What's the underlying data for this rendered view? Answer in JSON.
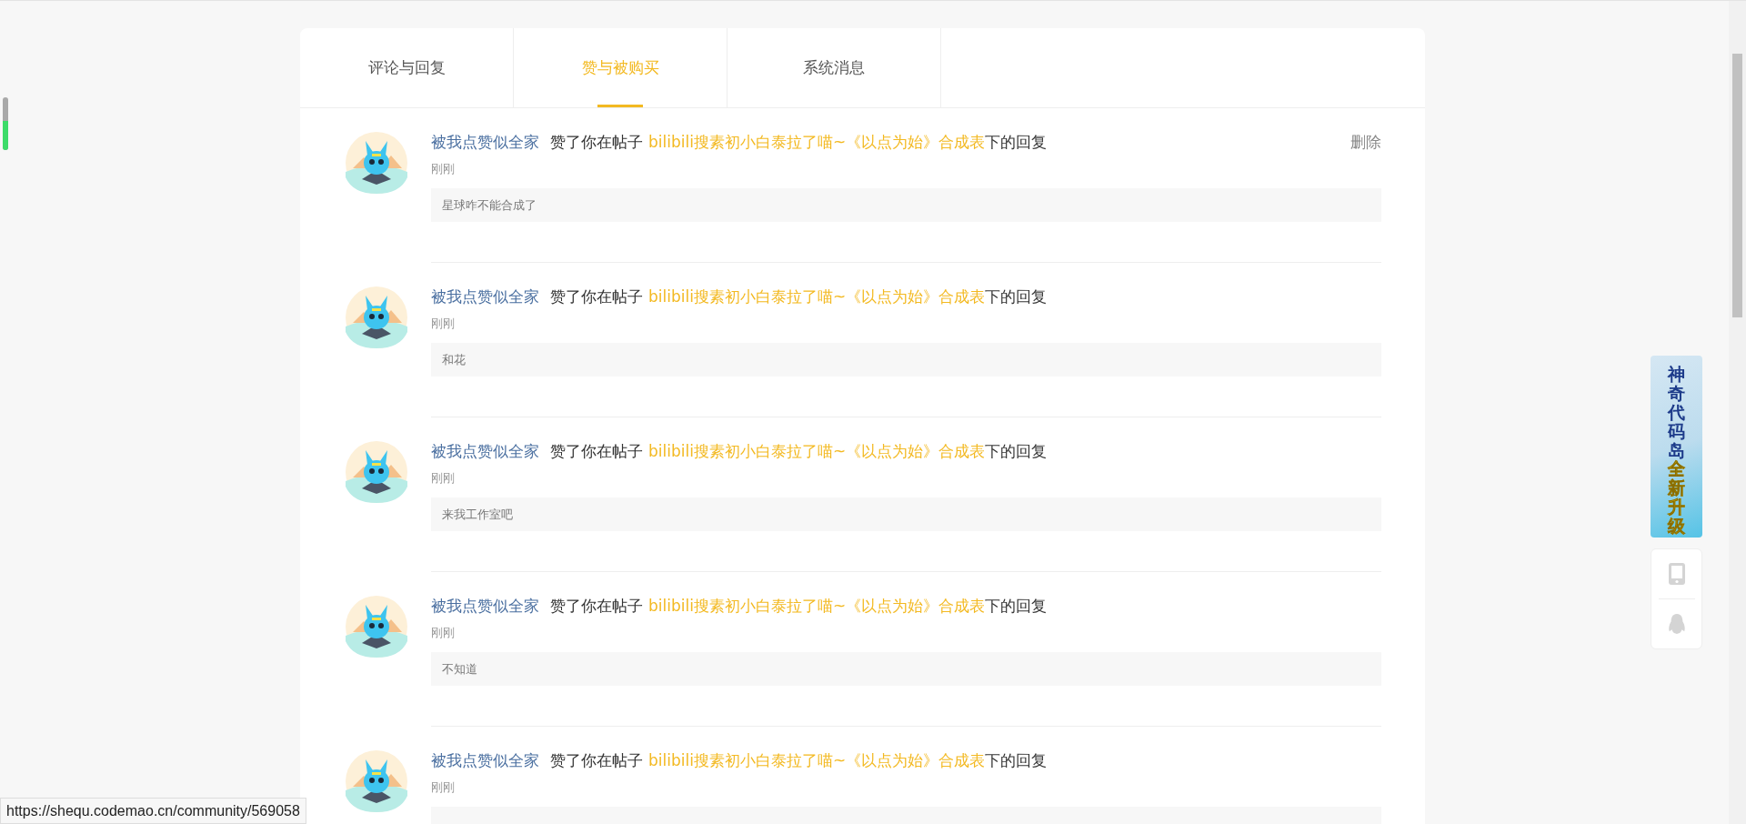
{
  "tabs": [
    {
      "label": "评论与回复",
      "selected": false
    },
    {
      "label": "赞与被购买",
      "selected": true
    },
    {
      "label": "系统消息",
      "selected": false
    }
  ],
  "notifications": [
    {
      "user": "被我点赞似全家",
      "action": "赞了你在帖子",
      "post": "bilibili搜素初小白泰拉了喵~《以点为始》合成表",
      "suffix": "下的回复",
      "time": "刚刚",
      "comment": "星球咋不能合成了",
      "delete": "删除"
    },
    {
      "user": "被我点赞似全家",
      "action": "赞了你在帖子",
      "post": "bilibili搜素初小白泰拉了喵~《以点为始》合成表",
      "suffix": "下的回复",
      "time": "刚刚",
      "comment": "和花"
    },
    {
      "user": "被我点赞似全家",
      "action": "赞了你在帖子",
      "post": "bilibili搜素初小白泰拉了喵~《以点为始》合成表",
      "suffix": "下的回复",
      "time": "刚刚",
      "comment": "来我工作室吧"
    },
    {
      "user": "被我点赞似全家",
      "action": "赞了你在帖子",
      "post": "bilibili搜素初小白泰拉了喵~《以点为始》合成表",
      "suffix": "下的回复",
      "time": "刚刚",
      "comment": "不知道"
    },
    {
      "user": "被我点赞似全家",
      "action": "赞了你在帖子",
      "post": "bilibili搜素初小白泰拉了喵~《以点为始》合成表",
      "suffix": "下的回复",
      "time": "刚刚"
    }
  ],
  "side_meter": {
    "level": 0.55
  },
  "promo_banner": {
    "title": "神奇代码岛",
    "subtitle": "全新升级"
  },
  "status_bar": {
    "url": "https://shequ.codemao.cn/community/569058"
  }
}
